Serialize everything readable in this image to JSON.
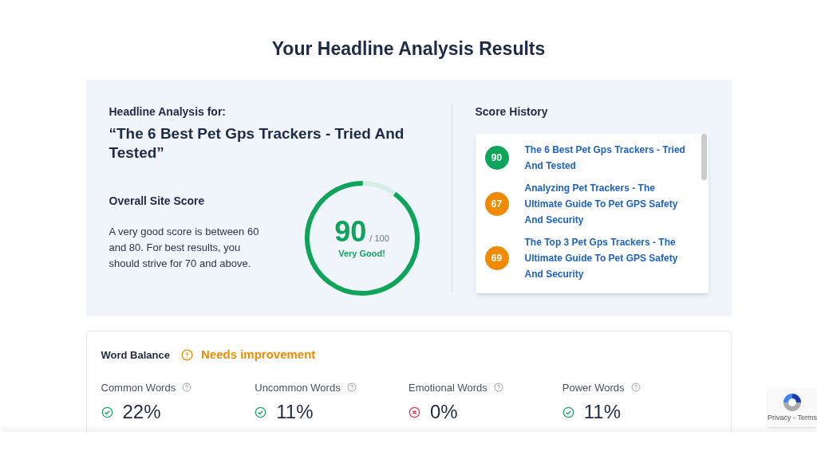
{
  "title": "Your Headline Analysis Results",
  "analysis": {
    "label": "Headline Analysis for:",
    "headline": "“The 6 Best Pet Gps Trackers - Tried And Tested”",
    "score_heading": "Overall Site Score",
    "description": "A very good score is between 60 and 80. For best results, you should strive for 70 and above.",
    "score": "90",
    "max": "/ 100",
    "verdict": "Very Good!",
    "level": 0.9
  },
  "score_history": {
    "heading": "Score History",
    "items": [
      {
        "score": "90",
        "color": "#0ea55a",
        "title": "The 6 Best Pet Gps Trackers - Tried And Tested"
      },
      {
        "score": "67",
        "color": "#f08a00",
        "title": "Analyzing Pet Trackers - The Ultimate Guide To Pet GPS Safety And Security"
      },
      {
        "score": "69",
        "color": "#f08a00",
        "title": "The Top 3 Pet Gps Trackers - The Ultimate Guide To Pet GPS Safety And Security"
      }
    ]
  },
  "word_balance": {
    "heading": "Word Balance",
    "status": "Needs improvement",
    "metrics": [
      {
        "label": "Common Words",
        "value": "22%",
        "kind": "good"
      },
      {
        "label": "Uncommon Words",
        "value": "11%",
        "kind": "good"
      },
      {
        "label": "Emotional Words",
        "value": "0%",
        "kind": "bad"
      },
      {
        "label": "Power Words",
        "value": "11%",
        "kind": "good"
      }
    ]
  },
  "recaptcha": {
    "links": "Privacy - Terms"
  }
}
